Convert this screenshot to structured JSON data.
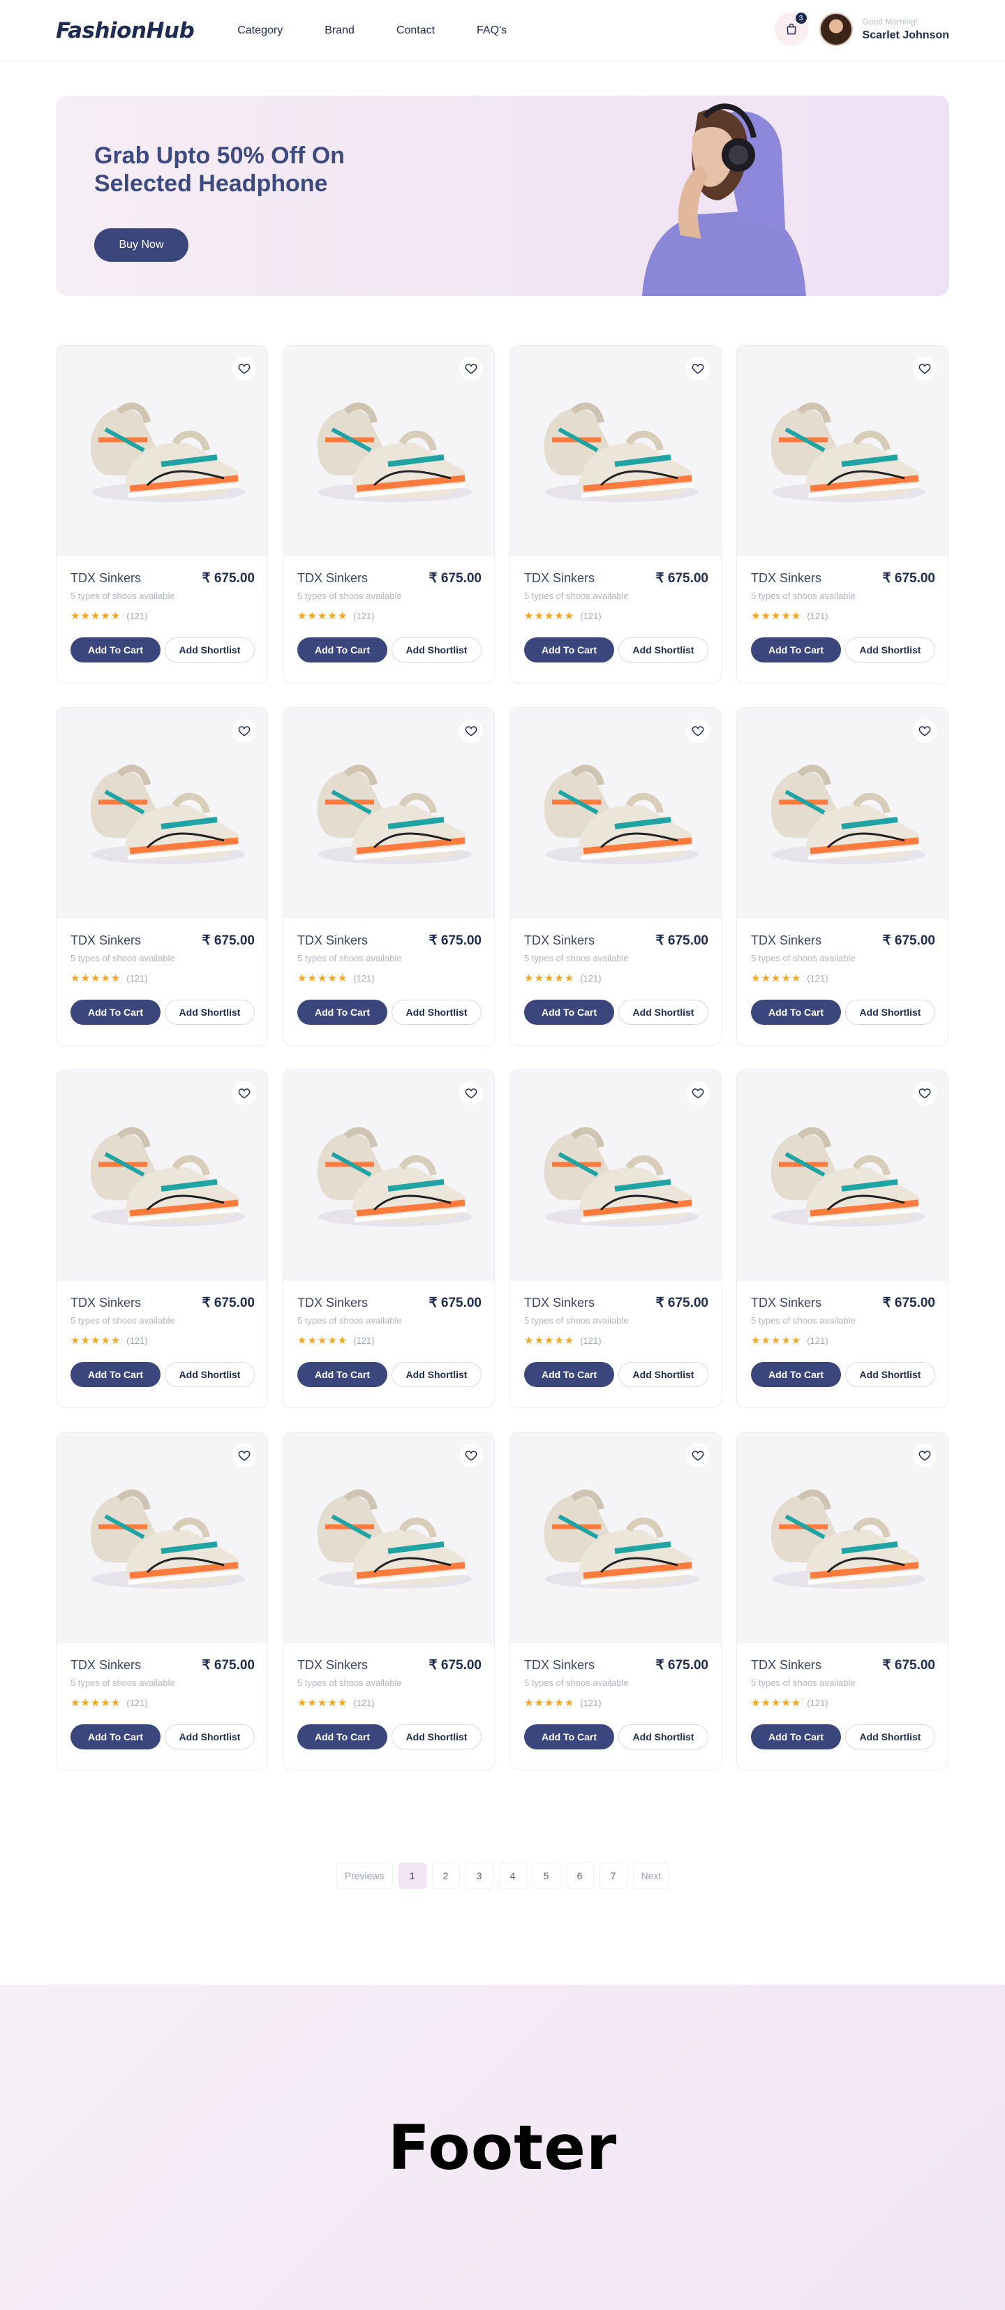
{
  "header": {
    "logo": "FashionHub",
    "nav": [
      "Category",
      "Brand",
      "Contact",
      "FAQ's"
    ],
    "cart_count": "3",
    "greeting": "Good Morning!",
    "user_name": "Scarlet Johnson"
  },
  "banner": {
    "title": "Grab Upto 50% Off On Selected Headphone",
    "button": "Buy Now"
  },
  "products": [
    {
      "name": "TDX Sinkers",
      "price": "₹ 675.00",
      "subtitle": "5 types of shoos available",
      "rating": 4.5,
      "reviews": "(121)",
      "cart_label": "Add To Cart",
      "shortlist_label": "Add Shortlist"
    },
    {
      "name": "TDX Sinkers",
      "price": "₹ 675.00",
      "subtitle": "5 types of shoos available",
      "rating": 4.5,
      "reviews": "(121)",
      "cart_label": "Add To Cart",
      "shortlist_label": "Add Shortlist"
    },
    {
      "name": "TDX Sinkers",
      "price": "₹ 675.00",
      "subtitle": "5 types of shoos available",
      "rating": 4.5,
      "reviews": "(121)",
      "cart_label": "Add To Cart",
      "shortlist_label": "Add Shortlist"
    },
    {
      "name": "TDX Sinkers",
      "price": "₹ 675.00",
      "subtitle": "5 types of shoos available",
      "rating": 4.5,
      "reviews": "(121)",
      "cart_label": "Add To Cart",
      "shortlist_label": "Add Shortlist"
    },
    {
      "name": "TDX Sinkers",
      "price": "₹ 675.00",
      "subtitle": "5 types of shoos available",
      "rating": 4.5,
      "reviews": "(121)",
      "cart_label": "Add To Cart",
      "shortlist_label": "Add Shortlist"
    },
    {
      "name": "TDX Sinkers",
      "price": "₹ 675.00",
      "subtitle": "5 types of shoos available",
      "rating": 4.5,
      "reviews": "(121)",
      "cart_label": "Add To Cart",
      "shortlist_label": "Add Shortlist"
    },
    {
      "name": "TDX Sinkers",
      "price": "₹ 675.00",
      "subtitle": "5 types of shoos available",
      "rating": 4.5,
      "reviews": "(121)",
      "cart_label": "Add To Cart",
      "shortlist_label": "Add Shortlist"
    },
    {
      "name": "TDX Sinkers",
      "price": "₹ 675.00",
      "subtitle": "5 types of shoos available",
      "rating": 4.5,
      "reviews": "(121)",
      "cart_label": "Add To Cart",
      "shortlist_label": "Add Shortlist"
    },
    {
      "name": "TDX Sinkers",
      "price": "₹ 675.00",
      "subtitle": "5 types of shoos available",
      "rating": 4.5,
      "reviews": "(121)",
      "cart_label": "Add To Cart",
      "shortlist_label": "Add Shortlist"
    },
    {
      "name": "TDX Sinkers",
      "price": "₹ 675.00",
      "subtitle": "5 types of shoos available",
      "rating": 4.5,
      "reviews": "(121)",
      "cart_label": "Add To Cart",
      "shortlist_label": "Add Shortlist"
    },
    {
      "name": "TDX Sinkers",
      "price": "₹ 675.00",
      "subtitle": "5 types of shoos available",
      "rating": 4.5,
      "reviews": "(121)",
      "cart_label": "Add To Cart",
      "shortlist_label": "Add Shortlist"
    },
    {
      "name": "TDX Sinkers",
      "price": "₹ 675.00",
      "subtitle": "5 types of shoos available",
      "rating": 4.5,
      "reviews": "(121)",
      "cart_label": "Add To Cart",
      "shortlist_label": "Add Shortlist"
    },
    {
      "name": "TDX Sinkers",
      "price": "₹ 675.00",
      "subtitle": "5 types of shoos available",
      "rating": 4.5,
      "reviews": "(121)",
      "cart_label": "Add To Cart",
      "shortlist_label": "Add Shortlist"
    },
    {
      "name": "TDX Sinkers",
      "price": "₹ 675.00",
      "subtitle": "5 types of shoos available",
      "rating": 4.5,
      "reviews": "(121)",
      "cart_label": "Add To Cart",
      "shortlist_label": "Add Shortlist"
    },
    {
      "name": "TDX Sinkers",
      "price": "₹ 675.00",
      "subtitle": "5 types of shoos available",
      "rating": 4.5,
      "reviews": "(121)",
      "cart_label": "Add To Cart",
      "shortlist_label": "Add Shortlist"
    },
    {
      "name": "TDX Sinkers",
      "price": "₹ 675.00",
      "subtitle": "5 types of shoos available",
      "rating": 4.5,
      "reviews": "(121)",
      "cart_label": "Add To Cart",
      "shortlist_label": "Add Shortlist"
    }
  ],
  "pagination": {
    "previous": "Previews",
    "pages": [
      "1",
      "2",
      "3",
      "4",
      "5",
      "6",
      "7"
    ],
    "active": "1",
    "next": "Next"
  },
  "footer": {
    "text": "Footer"
  },
  "colors": {
    "primary": "#3a467c",
    "brand_dark": "#1e2c52",
    "star": "#f4a621",
    "banner_bg": "#f2e6f4"
  }
}
